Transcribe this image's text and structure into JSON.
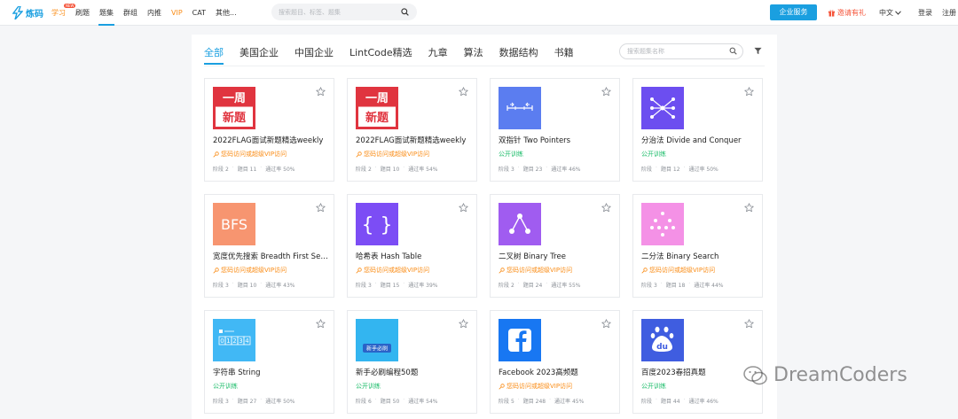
{
  "header": {
    "logo_text": "炼码",
    "nav": [
      {
        "label": "学习",
        "badge": "NEW",
        "style": "orange"
      },
      {
        "label": "刷题",
        "style": ""
      },
      {
        "label": "题集",
        "style": "active"
      },
      {
        "label": "群组",
        "style": ""
      },
      {
        "label": "内推",
        "style": ""
      },
      {
        "label": "VIP",
        "style": "orange"
      },
      {
        "label": "CAT",
        "style": ""
      },
      {
        "label": "其他...",
        "style": ""
      }
    ],
    "search_placeholder": "搜索题目、标签、题集",
    "enterprise_button": "企业服务",
    "invite_label": "邀请有礼",
    "language": "中文",
    "login": "登录",
    "register": "注册"
  },
  "tabs": [
    "全部",
    "美国企业",
    "中国企业",
    "LintCode精选",
    "九章",
    "算法",
    "数据结构",
    "书籍"
  ],
  "active_tab": 0,
  "set_search_placeholder": "搜索题集名称",
  "labels": {
    "stage": "阶段",
    "problems": "题目",
    "pass_rate": "通过率"
  },
  "cards": [
    {
      "title": "2022FLAG面试新题精选weekly",
      "access": "您码访问或超级VIP访问",
      "access_type": "vip",
      "stage": "2",
      "problems": "11",
      "pass_rate": "50%",
      "thumb": "weekly",
      "thumb_text": [
        "一周",
        "新题"
      ]
    },
    {
      "title": "2022FLAG面试新题精选weekly",
      "access": "您码访问或超级VIP访问",
      "access_type": "vip",
      "stage": "2",
      "problems": "10",
      "pass_rate": "54%",
      "thumb": "weekly",
      "thumb_text": [
        "一周",
        "新题"
      ]
    },
    {
      "title": "双指针 Two Pointers",
      "access": "公开训练",
      "access_type": "open",
      "stage": "3",
      "problems": "23",
      "pass_rate": "46%",
      "thumb": "two-pointers",
      "thumb_text": []
    },
    {
      "title": "分治法 Divide and Conquer",
      "access": "公开训练",
      "access_type": "open",
      "stage": "",
      "problems": "12",
      "pass_rate": "50%",
      "thumb": "divide",
      "thumb_text": []
    },
    {
      "title": "宽度优先搜索 Breadth First Search",
      "access": "您码访问或超级VIP访问",
      "access_type": "vip",
      "stage": "3",
      "problems": "10",
      "pass_rate": "43%",
      "thumb": "bfs",
      "thumb_text": [
        "BFS"
      ]
    },
    {
      "title": "哈希表 Hash Table",
      "access": "您码访问或超级VIP访问",
      "access_type": "vip",
      "stage": "3",
      "problems": "15",
      "pass_rate": "39%",
      "thumb": "hash",
      "thumb_text": [
        "{ }"
      ]
    },
    {
      "title": "二叉树 Binary Tree",
      "access": "您码访问或超级VIP访问",
      "access_type": "vip",
      "stage": "2",
      "problems": "24",
      "pass_rate": "55%",
      "thumb": "tree",
      "thumb_text": []
    },
    {
      "title": "二分法 Binary Search",
      "access": "您码访问或超级VIP访问",
      "access_type": "vip",
      "stage": "3",
      "problems": "18",
      "pass_rate": "44%",
      "thumb": "bsearch",
      "thumb_text": []
    },
    {
      "title": "字符串 String",
      "access": "公开训练",
      "access_type": "open",
      "stage": "3",
      "problems": "27",
      "pass_rate": "50%",
      "thumb": "string",
      "thumb_text": [
        "0",
        "1",
        "2",
        "3",
        "4"
      ]
    },
    {
      "title": "新手必刷编程50题",
      "access": "公开训练",
      "access_type": "open",
      "stage": "6",
      "problems": "50",
      "pass_rate": "54%",
      "thumb": "newbie",
      "thumb_text": [
        "</>",
        "新手必刷"
      ]
    },
    {
      "title": "Facebook 2023高频题",
      "access": "您码访问或超级VIP访问",
      "access_type": "vip",
      "stage": "5",
      "problems": "248",
      "pass_rate": "45%",
      "thumb": "facebook",
      "thumb_text": []
    },
    {
      "title": "百度2023春招真题",
      "access": "公开训练",
      "access_type": "open",
      "stage": "",
      "problems": "44",
      "pass_rate": "46%",
      "thumb": "baidu",
      "thumb_text": [
        "du"
      ]
    }
  ],
  "watermark": "DreamCoders",
  "colors": {
    "accent": "#1a9fe0",
    "vip": "#fa8c16",
    "open": "#1ebd6b",
    "weekly": "#e0343f",
    "two_pointers": "#5b7df0",
    "divide": "#6c4ef0",
    "bfs": "#f79570",
    "hash": "#7c4df5",
    "tree": "#a05cf0",
    "bsearch": "#f491e6",
    "string": "#41b8f5",
    "newbie": "#33b5f0",
    "facebook": "#1877f2",
    "baidu": "#3f5de0"
  }
}
